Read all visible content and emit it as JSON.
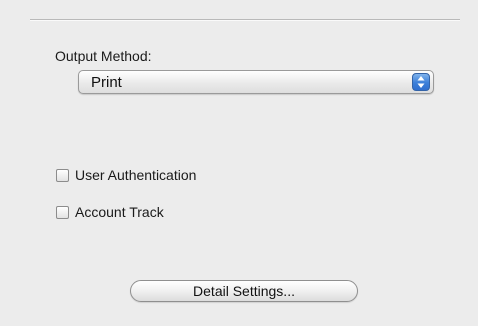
{
  "output_method": {
    "label": "Output Method:",
    "selected": "Print"
  },
  "options": [
    {
      "label": "User Authentication",
      "checked": false
    },
    {
      "label": "Account Track",
      "checked": false
    }
  ],
  "detail_settings_label": "Detail Settings...",
  "colors": {
    "panel_background": "#ececec",
    "popup_arrow_accent": "#3c7fd9"
  },
  "icons": {
    "popup_arrows": "up-down-chevron-icon"
  }
}
